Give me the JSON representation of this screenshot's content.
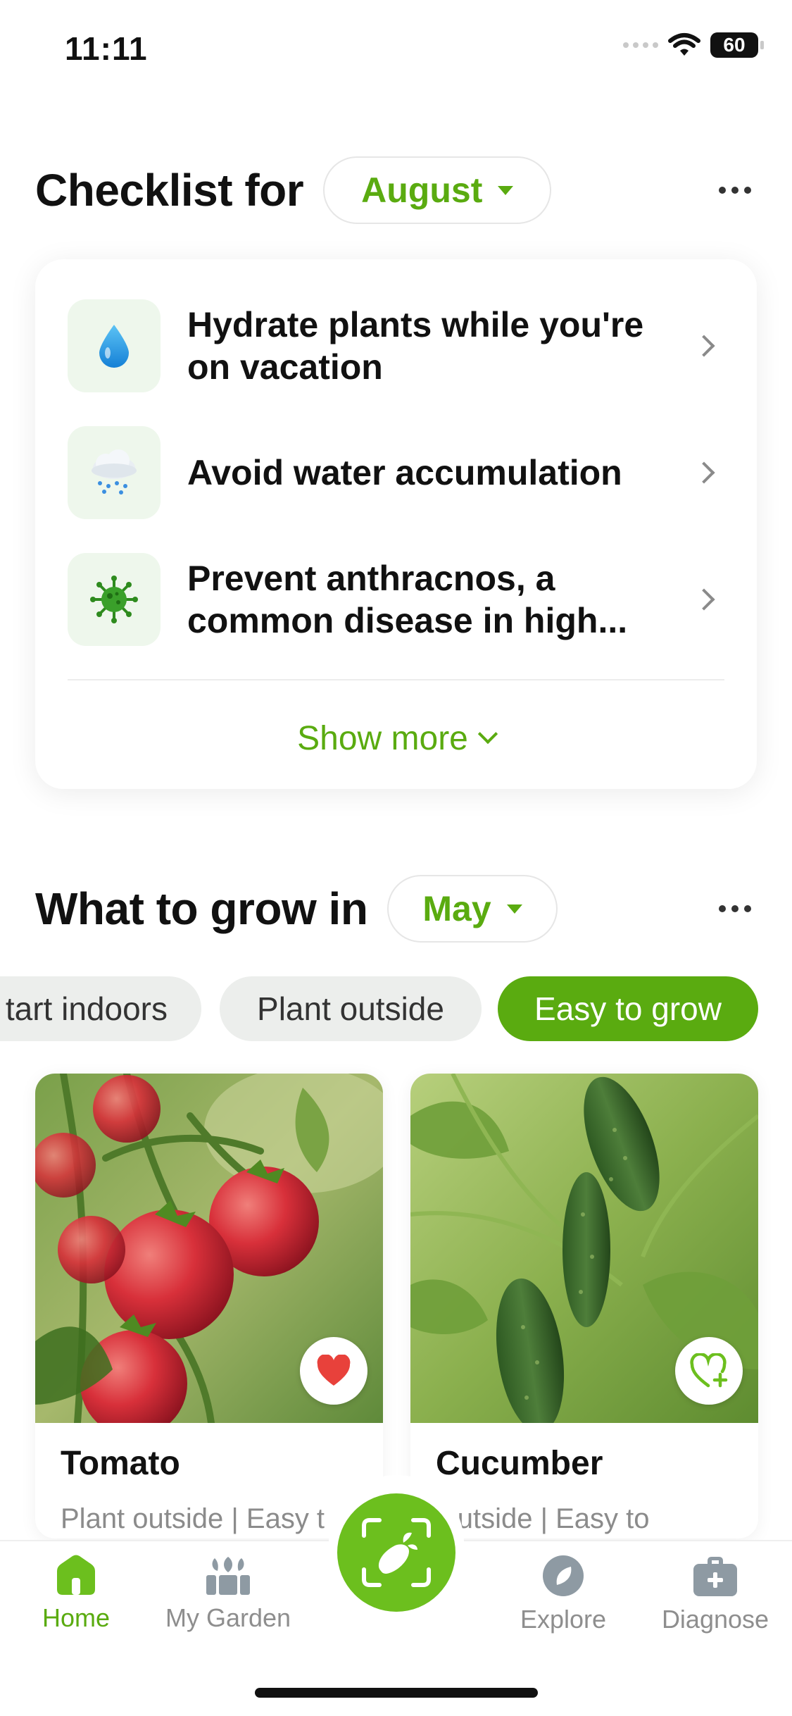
{
  "status_bar": {
    "time": "11:11",
    "battery": "60"
  },
  "checklist": {
    "title": "Checklist for",
    "month": "August",
    "items": [
      {
        "text": "Hydrate plants while you're on vacation",
        "icon": "water-drop-icon"
      },
      {
        "text": "Avoid water accumulation",
        "icon": "rain-cloud-icon"
      },
      {
        "text": "Prevent anthracnos, a common disease in high...",
        "icon": "virus-icon"
      }
    ],
    "show_more": "Show more"
  },
  "grow": {
    "title": "What to grow in",
    "month": "May",
    "chips": [
      {
        "label": "Start indoors",
        "visible_text": "tart indoors",
        "active": false
      },
      {
        "label": "Plant outside",
        "visible_text": "Plant outside",
        "active": false
      },
      {
        "label": "Easy to grow",
        "visible_text": "Easy to grow",
        "active": true
      }
    ],
    "plants": [
      {
        "name": "Tomato",
        "tags": "Plant outside | Easy t",
        "favorite": true
      },
      {
        "name": "Cucumber",
        "tags": "nt outside | Easy to",
        "favorite": false
      }
    ]
  },
  "nav": {
    "items": [
      {
        "label": "Home",
        "icon": "home-icon",
        "active": true
      },
      {
        "label": "My Garden",
        "icon": "garden-icon",
        "active": false
      },
      {
        "label": "Explore",
        "icon": "compass-icon",
        "active": false
      },
      {
        "label": "Diagnose",
        "icon": "first-aid-kit-icon",
        "active": false
      }
    ],
    "center": {
      "icon": "plant-scan-icon"
    }
  },
  "colors": {
    "accent": "#5aab10",
    "accent_button": "#6cbf1e",
    "heart": "#e8413b"
  }
}
